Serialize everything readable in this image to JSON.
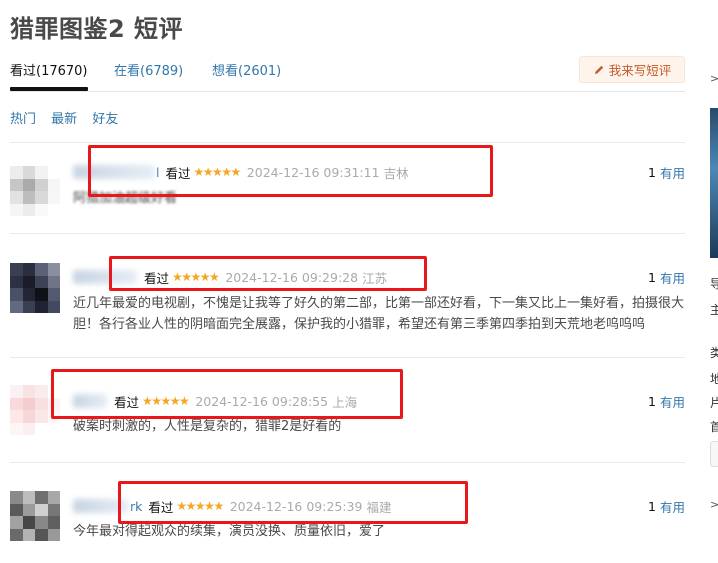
{
  "page": {
    "title": "猎罪图鉴2 短评"
  },
  "tabs": [
    {
      "label": "看过(17670)",
      "active": true
    },
    {
      "label": "在看(6789)",
      "active": false
    },
    {
      "label": "想看(2601)",
      "active": false
    }
  ],
  "write_button": {
    "label": "我来写短评",
    "icon": "pencil-icon"
  },
  "subtabs": [
    {
      "label": "热门",
      "active": false
    },
    {
      "label": "最新",
      "active": false
    },
    {
      "label": "好友",
      "active": false
    }
  ],
  "comments": [
    {
      "username_tail": "l",
      "status": "看过",
      "stars": "★★★★★",
      "time": "2024-12-16 09:31:11",
      "location": "吉林",
      "useful_count": "1",
      "useful_label": "有用",
      "content": "阿猎加油超级好看"
    },
    {
      "username_tail": "",
      "status": "看过",
      "stars": "★★★★★",
      "time": "2024-12-16 09:29:28",
      "location": "江苏",
      "useful_count": "1",
      "useful_label": "有用",
      "content": "近几年最爱的电视剧，不愧是让我等了好久的第二部，比第一部还好看，下一集又比上一集好看，拍摄很大胆！各行各业人性的阴暗面完全展露，保护我的小猎罪，希望还有第三季第四季拍到天荒地老呜呜呜"
    },
    {
      "username_tail": "",
      "status": "看过",
      "stars": "★★★★★",
      "time": "2024-12-16 09:28:55",
      "location": "上海",
      "useful_count": "1",
      "useful_label": "有用",
      "content": "破案时刺激的，人性是复杂的，猎罪2是好看的"
    },
    {
      "username_tail": "rk",
      "status": "看过",
      "stars": "★★★★★",
      "time": "2024-12-16 09:25:39",
      "location": "福建",
      "useful_count": "1",
      "useful_label": "有用",
      "content": "今年最对得起观众的续集，演员没换、质量依旧，爱了"
    }
  ],
  "right_column": {
    "arrows": [
      ">",
      ">"
    ],
    "texts": [
      "导",
      "主",
      "类",
      "地",
      "片",
      "首"
    ]
  },
  "colors": {
    "link": "#3377aa",
    "star": "#f5a623",
    "highlight_box": "#e8171c",
    "write_button_bg": "#fff4ec"
  }
}
